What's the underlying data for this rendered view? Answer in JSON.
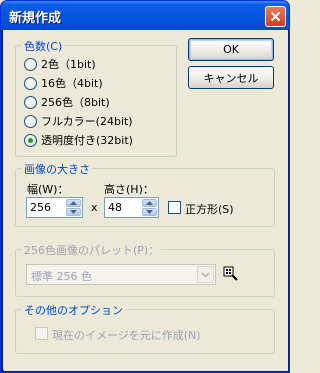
{
  "window": {
    "title": "新規作成"
  },
  "color_group": {
    "label": "色数(C)",
    "options": [
      {
        "label": "2色（1bit)",
        "checked": false
      },
      {
        "label": "16色（4bit)",
        "checked": false
      },
      {
        "label": "256色（8bit)",
        "checked": false
      },
      {
        "label": "フルカラー(24bit)",
        "checked": false
      },
      {
        "label": "透明度付き(32bit)",
        "checked": true
      }
    ]
  },
  "buttons": {
    "ok": "OK",
    "cancel": "キャンセル"
  },
  "size_group": {
    "label": "画像の大きさ",
    "width_label": "幅(W)：",
    "height_label": "高さ(H)：",
    "width_value": "256",
    "height_value": "48",
    "times": "x",
    "square_label": "正方形(S)",
    "square_checked": false
  },
  "palette_group": {
    "label": "256色画像のパレット(P)：",
    "selected": "標準 256 色"
  },
  "other_group": {
    "label": "その他のオプション",
    "create_from_current": "現在のイメージを元に作成(N)"
  }
}
